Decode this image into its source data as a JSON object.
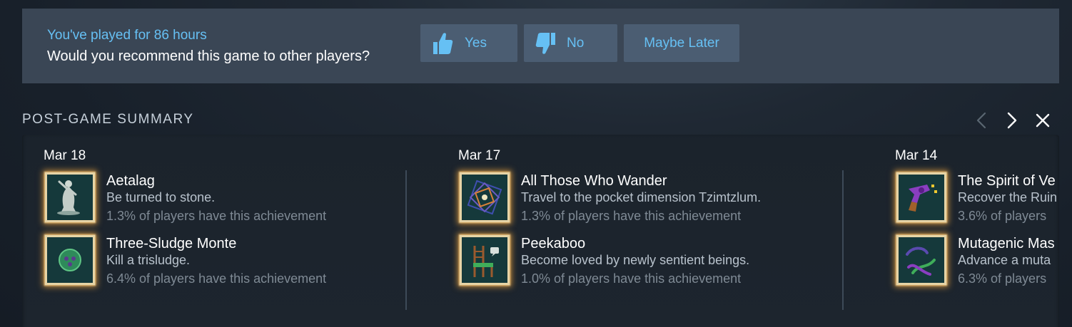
{
  "recommend": {
    "played_text": "You've played for 86 hours",
    "question": "Would you recommend this game to other players?",
    "yes_label": "Yes",
    "no_label": "No",
    "later_label": "Maybe Later"
  },
  "summary": {
    "title": "POST-GAME SUMMARY",
    "days": [
      {
        "date": "Mar 18",
        "achievements": [
          {
            "name": "Aetalag",
            "description": "Be turned to stone.",
            "percent": "1.3% of players have this achievement",
            "icon": "stone-statue-icon"
          },
          {
            "name": "Three-Sludge Monte",
            "description": "Kill a trisludge.",
            "percent": "6.4% of players have this achievement",
            "icon": "trisludge-icon"
          }
        ]
      },
      {
        "date": "Mar 17",
        "achievements": [
          {
            "name": "All Those Who Wander",
            "description": "Travel to the pocket dimension Tzimtzlum.",
            "percent": "1.3% of players have this achievement",
            "icon": "pocket-dimension-icon"
          },
          {
            "name": "Peekaboo",
            "description": "Become loved by newly sentient beings.",
            "percent": "1.0% of players have this achievement",
            "icon": "sentient-chair-icon"
          }
        ]
      },
      {
        "date": "Mar 14",
        "achievements": [
          {
            "name": "The Spirit of Ve",
            "description": "Recover the Ruin",
            "percent": "3.6% of players",
            "icon": "revolver-icon"
          },
          {
            "name": "Mutagenic Mas",
            "description": "Advance a muta",
            "percent": "6.3% of players",
            "icon": "mutation-tentacles-icon"
          }
        ]
      }
    ]
  },
  "colors": {
    "accent": "#66c0f4",
    "button_bg": "#4b5d72",
    "bar_bg": "#3a4655",
    "glow": "#e8a03c"
  }
}
